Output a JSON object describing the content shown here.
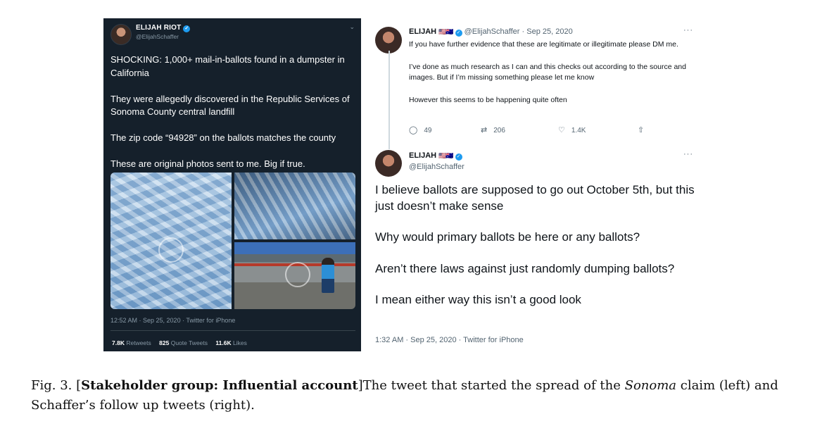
{
  "left_tweet": {
    "name": "ELIJAH RIOT",
    "handle": "@ElijahSchaffer",
    "paragraphs": [
      "SHOCKING: 1,000+ mail-in-ballots found in a dumpster in California",
      "They were allegedly discovered in the Republic Services of Sonoma County central landfill",
      "The zip code “94928” on the ballots matches the county",
      "These are original photos sent to me. Big if true."
    ],
    "timestamp": "12:52 AM · Sep 25, 2020 · Twitter for iPhone",
    "stats": {
      "retweets_count": "7.8K",
      "retweets_label": "Retweets",
      "quotes_count": "825",
      "quotes_label": "Quote Tweets",
      "likes_count": "11.6K",
      "likes_label": "Likes"
    },
    "colors": {
      "background": "#15202b",
      "text": "#ffffff",
      "muted": "#8899a6"
    }
  },
  "right_tweet_1": {
    "name": "ELIJAH",
    "flags": "🇺🇸🇦🇺",
    "handle": "@ElijahSchaffer",
    "date": "· Sep 25, 2020",
    "more": "···",
    "paragraphs": [
      "If you have further evidence that these are legitimate or illegitimate please DM me.",
      "I’ve done as much research as I can and this checks out according to the source and images. But if I’m missing something please let me know",
      "However this seems to be happening quite often"
    ],
    "actions": {
      "replies": "49",
      "retweets": "206",
      "likes": "1.4K"
    }
  },
  "right_tweet_2": {
    "name": "ELIJAH",
    "flags": "🇺🇸🇦🇺",
    "handle": "@ElijahSchaffer",
    "more": "···",
    "paragraphs": [
      "I believe ballots are supposed to go out October 5th, but this just doesn’t make sense",
      "Why would primary ballots be here or any ballots?",
      "Aren’t there laws against just randomly dumping ballots?",
      "I mean either way this isn’t a good look"
    ],
    "timestamp": "1:32 AM · Sep 25, 2020 · Twitter for iPhone"
  },
  "icons": {
    "verified": "verified-badge-icon",
    "reply": "reply-icon",
    "retweet": "retweet-icon",
    "like": "heart-icon",
    "share": "share-icon",
    "chevron": "chevron-down-icon"
  },
  "caption": {
    "prefix": "Fig. 3.  [",
    "bold": "Stakeholder group: Influential account",
    "middle": "]The tweet that started the spread of the ",
    "italic": "Sonoma",
    "suffix": " claim (left) and Schaffer’s follow up tweets (right)."
  }
}
